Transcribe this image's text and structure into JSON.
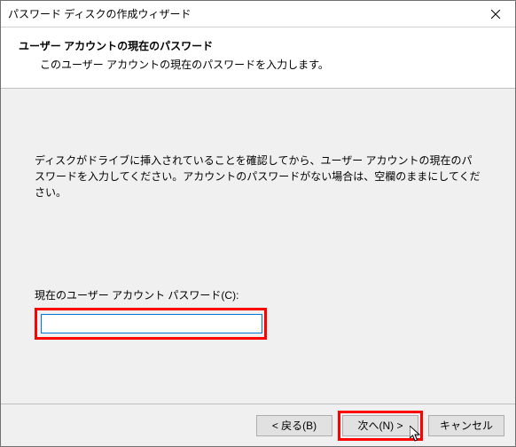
{
  "titlebar": {
    "title": "パスワード ディスクの作成ウィザード"
  },
  "header": {
    "title": "ユーザー アカウントの現在のパスワード",
    "subtitle": "このユーザー アカウントの現在のパスワードを入力します。"
  },
  "body": {
    "instruction": "ディスクがドライブに挿入されていることを確認してから、ユーザー アカウントの現在のパスワードを入力してください。アカウントのパスワードがない場合は、空欄のままにしてください。",
    "password_label": "現在のユーザー アカウント パスワード(C):",
    "password_value": ""
  },
  "footer": {
    "back_label": "< 戻る(B)",
    "next_label": "次へ(N) >",
    "cancel_label": "キャンセル"
  }
}
